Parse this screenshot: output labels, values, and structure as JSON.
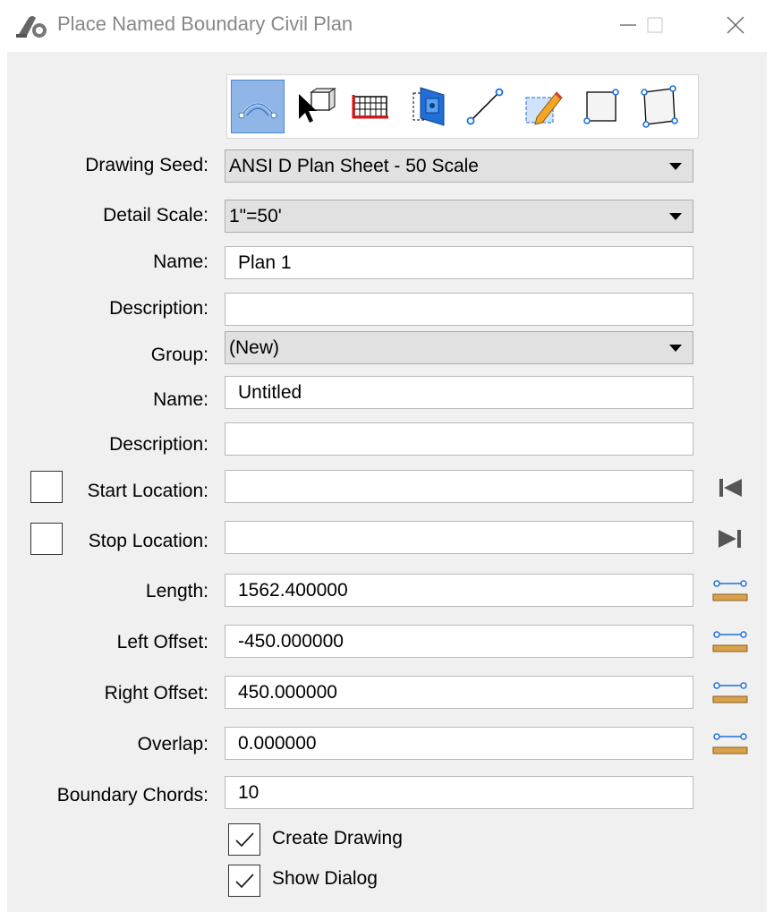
{
  "window": {
    "title": "Place Named Boundary Civil Plan",
    "minimize": "minimize",
    "maximize": "maximize",
    "close": "close"
  },
  "toolbar": {
    "tools": [
      {
        "icon": "civil-plan-boundary-icon",
        "active": true
      },
      {
        "icon": "select-element-icon",
        "active": false
      },
      {
        "icon": "grid-icon",
        "active": false
      },
      {
        "icon": "3d-view-icon",
        "active": false
      },
      {
        "icon": "line-between-points-icon",
        "active": false
      },
      {
        "icon": "pencil-edit-icon",
        "active": false
      },
      {
        "icon": "rectangle-icon",
        "active": false
      },
      {
        "icon": "polygon-icon",
        "active": false
      }
    ]
  },
  "form": {
    "drawing_seed": {
      "label": "Drawing Seed:",
      "value": "ANSI D Plan Sheet - 50 Scale"
    },
    "detail_scale": {
      "label": "Detail Scale:",
      "value": "1\"=50'"
    },
    "name": {
      "label": "Name:",
      "value": "Plan 1"
    },
    "description": {
      "label": "Description:",
      "value": ""
    },
    "group": {
      "label": "Group:",
      "value": "(New)"
    },
    "group_name": {
      "label": "Name:",
      "value": "Untitled"
    },
    "group_description": {
      "label": "Description:",
      "value": ""
    },
    "start_location": {
      "label": "Start Location:",
      "value": "",
      "checked": false
    },
    "stop_location": {
      "label": "Stop Location:",
      "value": "",
      "checked": false
    },
    "length": {
      "label": "Length:",
      "value": "1562.400000"
    },
    "left_offset": {
      "label": "Left Offset:",
      "value": "-450.000000"
    },
    "right_offset": {
      "label": "Right Offset:",
      "value": "450.000000"
    },
    "overlap": {
      "label": "Overlap:",
      "value": "0.000000"
    },
    "boundary_chords": {
      "label": "Boundary Chords:",
      "value": "10"
    },
    "create_drawing": {
      "label": "Create Drawing",
      "checked": true
    },
    "show_dialog": {
      "label": "Show Dialog",
      "checked": true
    }
  }
}
